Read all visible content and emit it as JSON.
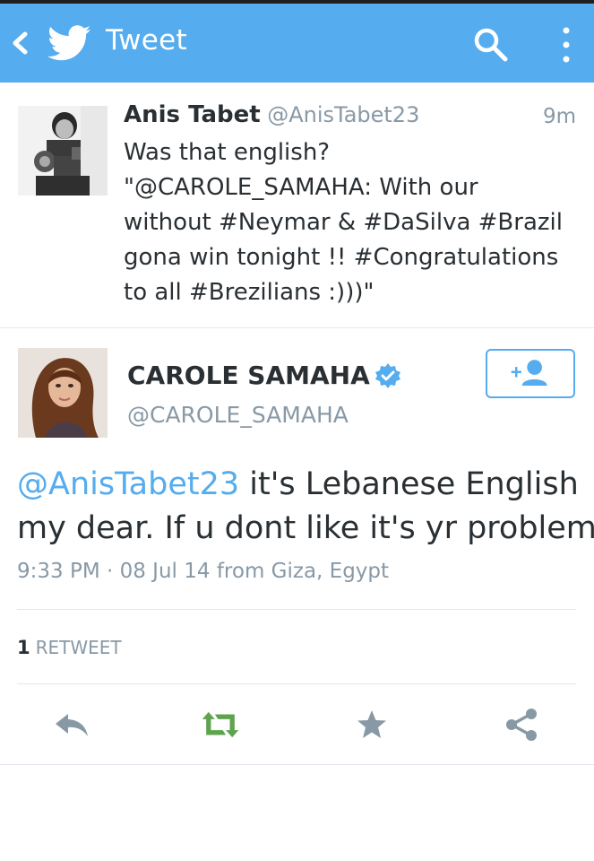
{
  "app_bar": {
    "title": "Tweet",
    "icons": [
      "back-chevron-icon",
      "twitter-bird-icon",
      "search-icon",
      "overflow-menu-icon"
    ],
    "background": "#55acee"
  },
  "reply_tweet": {
    "name": "Anis Tabet",
    "handle": "@AnisTabet23",
    "time": "9m",
    "lines": [
      "Was that english?",
      "\"@CAROLE_SAMAHA: With our",
      "without #Neymar & #DaSilva #Brazil",
      "gona win tonight !! #Congratulations",
      "to all #Brezilians :)))\""
    ]
  },
  "main_tweet": {
    "name": "CAROLE SAMAHA",
    "handle": "@CAROLE_SAMAHA",
    "verified": true,
    "mention": "@AnisTabet23",
    "text_line1_rest": " it's Lebanese English",
    "text_line2": "my dear. If u dont like it's yr problem.",
    "meta": "9:33 PM · 08 Jul 14 from Giza, Egypt",
    "follow_icon": "add-user-icon"
  },
  "stats": {
    "retweet_count": "1",
    "retweet_label": "RETWEET"
  },
  "actions": {
    "icons": [
      "reply-icon",
      "retweet-icon",
      "favorite-icon",
      "share-icon"
    ],
    "retweet_color": "#5ea44e",
    "icon_color": "#8899a6"
  }
}
